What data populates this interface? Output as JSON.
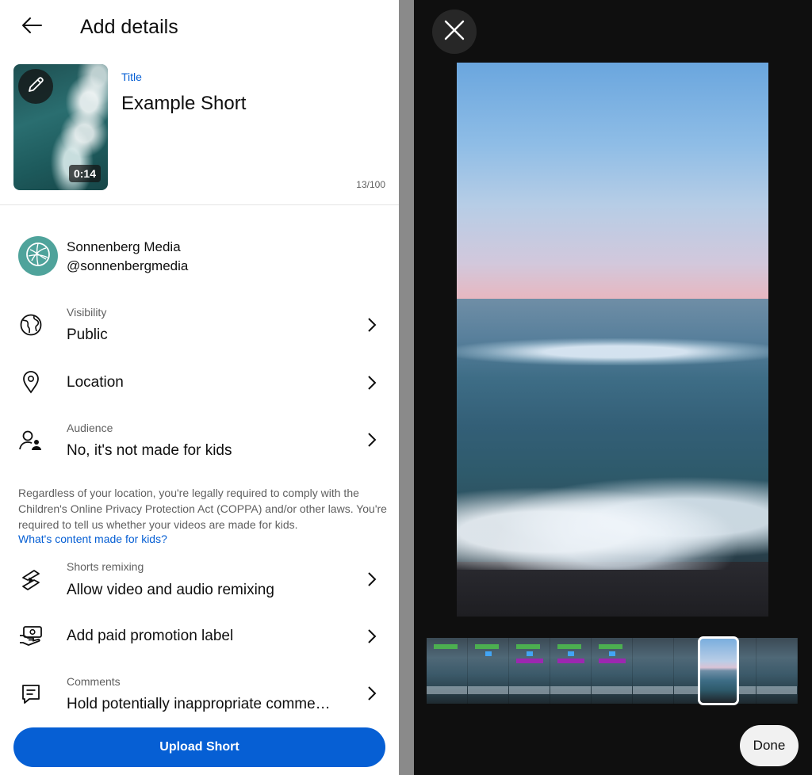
{
  "header": {
    "title": "Add details"
  },
  "video": {
    "duration": "0:14"
  },
  "title_field": {
    "label": "Title",
    "value": "Example Short",
    "char_count": "13/100"
  },
  "channel": {
    "name": "Sonnenberg Media",
    "handle": "@sonnenbergmedia"
  },
  "settings": {
    "visibility": {
      "label": "Visibility",
      "value": "Public"
    },
    "location": {
      "value": "Location"
    },
    "audience": {
      "label": "Audience",
      "value": "No, it's not made for kids"
    },
    "remixing": {
      "label": "Shorts remixing",
      "value": "Allow video and audio remixing"
    },
    "paid_promotion": {
      "value": "Add paid promotion label"
    },
    "comments": {
      "label": "Comments",
      "value": "Hold potentially inappropriate comme…"
    }
  },
  "notice": {
    "text": "Regardless of your location, you're legally required to comply with the Children's Online Privacy Protection Act (COPPA) and/or other laws. You're required to tell us whether your videos are made for kids.",
    "link": "What's content made for kids?"
  },
  "actions": {
    "upload": "Upload Short",
    "done": "Done"
  },
  "colors": {
    "accent": "#065fd4",
    "avatar": "#4fa39b",
    "dark_panel": "#0f0f0f"
  },
  "icons": [
    "arrow-back-icon",
    "pencil-icon",
    "globe-icon",
    "location-pin-icon",
    "audience-icon",
    "shorts-remix-icon",
    "paid-promotion-icon",
    "comment-icon",
    "chevron-right-icon",
    "close-icon"
  ]
}
